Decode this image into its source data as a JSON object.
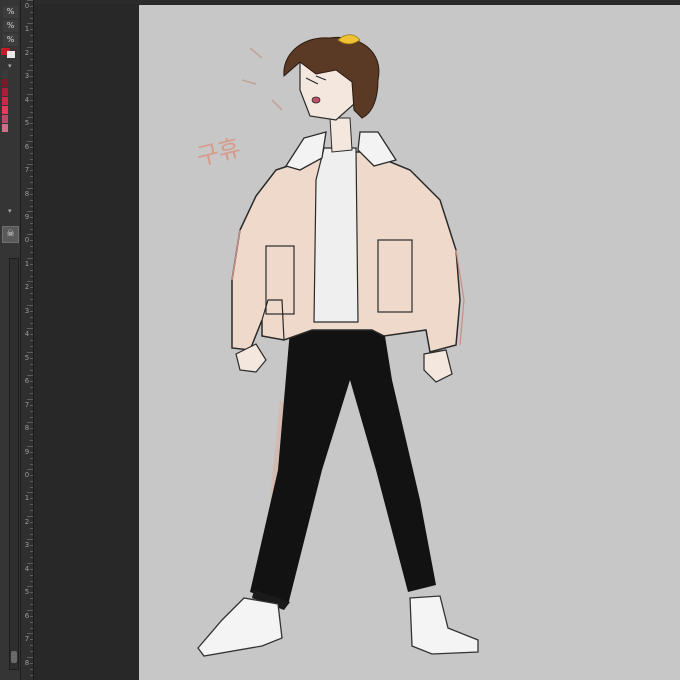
{
  "tool_panel": {
    "percent_buttons": [
      "%",
      "%",
      "%"
    ],
    "foreground_color": "#c41a2a",
    "background_color": "#e8e8e8",
    "swatches": [
      "#3a3a3a",
      "#7a1a28",
      "#a81e3a",
      "#c82a4a",
      "#e03c5a",
      "#b84a6a",
      "#d07088"
    ],
    "collapse_arrows": [
      "▾",
      "▾"
    ],
    "layer_thumb_glyph": "☠"
  },
  "ruler": {
    "labels": [
      "0",
      "1",
      "2",
      "3",
      "4",
      "5",
      "6",
      "7",
      "8",
      "9",
      "0",
      "1",
      "2",
      "3",
      "4",
      "5",
      "6",
      "7",
      "8",
      "9",
      "0",
      "1",
      "2",
      "3",
      "4",
      "5",
      "6",
      "7",
      "8"
    ]
  },
  "canvas": {
    "background": "#c7c7c7",
    "sketch_text": "구휴"
  },
  "colors": {
    "app_background": "#282828",
    "panel": "#353535",
    "jacket": "#efd9ca",
    "pants": "#121212",
    "hair": "#5a3a24",
    "skin": "#f3e7de",
    "shirt": "#efefef",
    "shoes": "#f4f4f4"
  }
}
